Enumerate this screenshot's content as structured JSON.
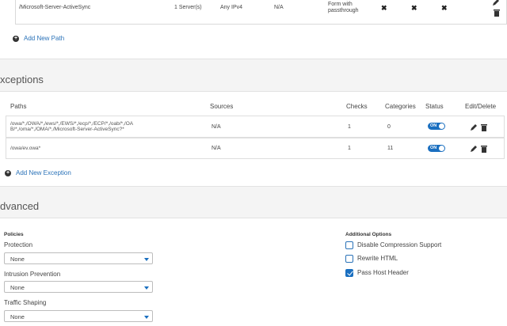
{
  "path_row": {
    "path": "/Microsoft-Server-ActiveSync",
    "servers": "1 Server(s)",
    "ip": "Any IPv4",
    "na": "N/A",
    "auth": "Form with passthrough",
    "x1": "✖",
    "x2": "✖",
    "x3": "✖"
  },
  "add_new_path": "Add New Path",
  "exceptions": {
    "title": "xceptions",
    "headers": {
      "paths": "Paths",
      "sources": "Sources",
      "checks": "Checks",
      "categories": "Categories",
      "status": "Status",
      "edit_delete": "Edit/Delete"
    },
    "rows": [
      {
        "path_line1": "/owa/*,/OWA/*,/ews/*,/EWS/*,/ecp/*,/ECP/*,/oab/*,/OA",
        "path_line2": "B/*,/oma/*,/OMA/*,/Microsoft-Server-ActiveSync?*",
        "sources": "N/A",
        "checks": "1",
        "categories": "0",
        "status": "ON"
      },
      {
        "path_line1": "/owa/ev.owa*",
        "path_line2": "",
        "sources": "N/A",
        "checks": "1",
        "categories": "11",
        "status": "ON"
      }
    ],
    "add_new_exception": "Add New Exception"
  },
  "advanced": {
    "title": "dvanced",
    "policies_head": "Policies",
    "protection_label": "Protection",
    "protection_value": "None",
    "ips_label": "Intrusion Prevention",
    "ips_value": "None",
    "traffic_label": "Traffic Shaping",
    "traffic_value": "None",
    "additional_head": "Additional Options",
    "opt1": "Disable Compression Support",
    "opt2": "Rewrite HTML",
    "opt3": "Pass Host Header",
    "opt1_checked": false,
    "opt2_checked": false,
    "opt3_checked": true
  },
  "colors": {
    "accent": "#1a6fc0",
    "link": "#2a72b8"
  }
}
